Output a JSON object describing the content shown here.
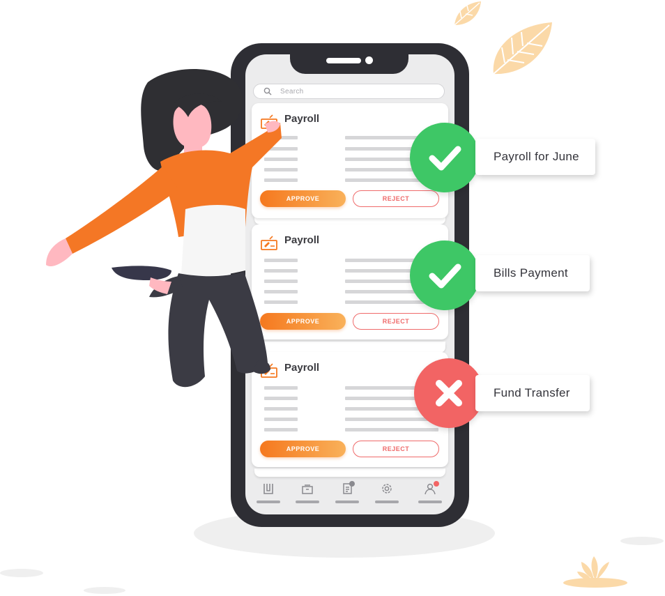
{
  "search": {
    "placeholder": "Search"
  },
  "cards": [
    {
      "title": "Payroll",
      "approve_label": "APPROVE",
      "reject_label": "REJECT"
    },
    {
      "title": "Payroll",
      "approve_label": "APPROVE",
      "reject_label": "REJECT"
    },
    {
      "title": "Payroll",
      "approve_label": "APPROVE",
      "reject_label": "REJECT"
    }
  ],
  "statuses": [
    {
      "label": "Payroll for June",
      "state": "approved",
      "color": "#3ec766"
    },
    {
      "label": "Bills Payment",
      "state": "approved",
      "color": "#3ec766"
    },
    {
      "label": "Fund Transfer",
      "state": "rejected",
      "color": "#f26464"
    }
  ],
  "nav": {
    "items": [
      "home-icon",
      "payments-icon",
      "documents-icon",
      "settings-icon",
      "profile-icon"
    ]
  },
  "colors": {
    "accent": "#f5781e",
    "reject": "#ef6a6a",
    "approve_badge": "#3ec766",
    "reject_badge": "#f26464",
    "phone_body": "#2e2e34",
    "leaf": "#fbd9a8"
  }
}
